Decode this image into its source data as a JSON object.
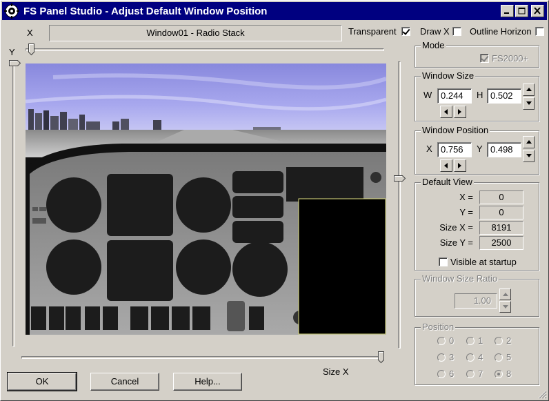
{
  "window": {
    "title": "FS Panel Studio - Adjust Default Window Position",
    "icons": {
      "app": "gear-icon",
      "minimize": "minimize-icon",
      "maximize": "maximize-icon",
      "close": "close-icon"
    }
  },
  "top": {
    "x_label": "X",
    "y_label": "Y",
    "window_name": "Window01 - Radio Stack",
    "transparent_label": "Transparent",
    "transparent_checked": true,
    "drawx_label": "Draw X",
    "drawx_checked": false,
    "outline_label": "Outline Horizon",
    "outline_checked": false
  },
  "sliders": {
    "x_value": 0.0,
    "y_value": 0.0,
    "size_x_value": 1.0,
    "size_y_value": 0.5,
    "size_x_label": "Size X"
  },
  "mode": {
    "title": "Mode",
    "fs2000_label": "FS2000+",
    "fs2000_checked": true
  },
  "window_size": {
    "title": "Window Size",
    "w_label": "W",
    "w_value": "0.244",
    "h_label": "H",
    "h_value": "0.502"
  },
  "window_position": {
    "title": "Window Position",
    "x_label": "X",
    "x_value": "0.756",
    "y_label": "Y",
    "y_value": "0.498"
  },
  "default_view": {
    "title": "Default View",
    "x_label": "X =",
    "x_value": "0",
    "y_label": "Y =",
    "y_value": "0",
    "size_x_label": "Size X =",
    "size_x_value": "8191",
    "size_y_label": "Size Y =",
    "size_y_value": "2500",
    "visible_label": "Visible at startup",
    "visible_checked": false
  },
  "ratio": {
    "title": "Window Size Ratio",
    "value": "1.00"
  },
  "position": {
    "title": "Position",
    "options": [
      "0",
      "1",
      "2",
      "3",
      "4",
      "5",
      "6",
      "7",
      "8"
    ],
    "selected": "8"
  },
  "buttons": {
    "ok": "OK",
    "cancel": "Cancel",
    "help": "Help..."
  },
  "colors": {
    "face": "#d4d0c8",
    "title": "#000080",
    "highlight": "#ffffff",
    "shadow": "#808080",
    "preview_outline": "#e0e080"
  }
}
